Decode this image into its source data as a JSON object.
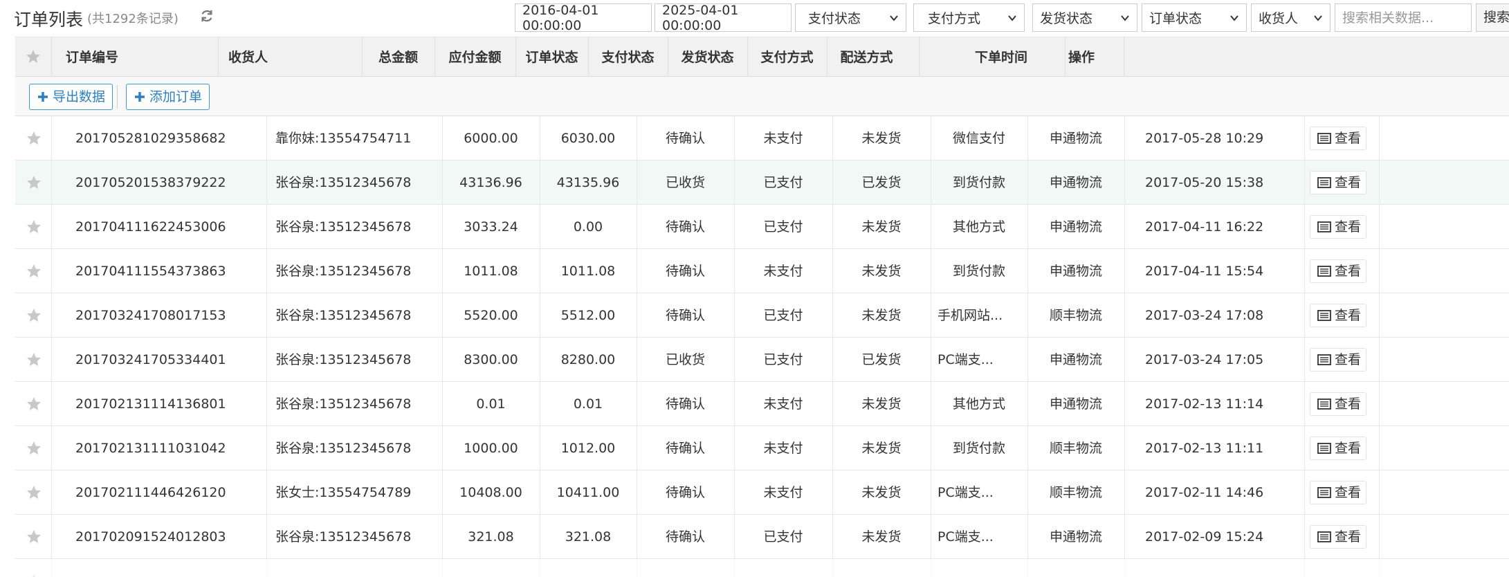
{
  "header": {
    "title": "订单列表",
    "record_count": "(共1292条记录)",
    "refresh_icon": "refresh-icon"
  },
  "filters": {
    "date_start": "2016-04-01 00:00:00",
    "date_end": "2025-04-01 00:00:00",
    "pay_status": "支付状态",
    "pay_method": "支付方式",
    "ship_status": "发货状态",
    "order_status": "订单状态",
    "receiver": "收货人",
    "search_placeholder": "搜索相关数据...",
    "search_button": "搜索"
  },
  "columns": {
    "order_no": "订单编号",
    "receiver": "收货人",
    "total": "总金额",
    "payable": "应付金额",
    "order_status": "订单状态",
    "pay_status": "支付状态",
    "ship_status": "发货状态",
    "pay_method": "支付方式",
    "delivery": "配送方式",
    "order_time": "下单时间",
    "actions": "操作"
  },
  "toolbar": {
    "export_label": "导出数据",
    "add_label": "添加订单"
  },
  "view_label": "查看",
  "colors": {
    "accent": "#2a7fc4",
    "row_highlight": "#f1f8f5",
    "header_bg": "#f1f1f1"
  },
  "rows": [
    {
      "order_no": "201705281029358682",
      "receiver": "靠你妹:13554754711",
      "total": "6000.00",
      "payable": "6030.00",
      "order_status": "待确认",
      "pay_status": "未支付",
      "ship_status": "未发货",
      "pay_method": "微信支付",
      "delivery": "申通物流",
      "time": "2017-05-28 10:29"
    },
    {
      "order_no": "201705201538379222",
      "receiver": "张谷泉:13512345678",
      "total": "43136.96",
      "payable": "43135.96",
      "order_status": "已收货",
      "pay_status": "已支付",
      "ship_status": "已发货",
      "pay_method": "到货付款",
      "delivery": "申通物流",
      "time": "2017-05-20 15:38"
    },
    {
      "order_no": "201704111622453006",
      "receiver": "张谷泉:13512345678",
      "total": "3033.24",
      "payable": "0.00",
      "order_status": "待确认",
      "pay_status": "已支付",
      "ship_status": "未发货",
      "pay_method": "其他方式",
      "delivery": "申通物流",
      "time": "2017-04-11 16:22"
    },
    {
      "order_no": "201704111554373863",
      "receiver": "张谷泉:13512345678",
      "total": "1011.08",
      "payable": "1011.08",
      "order_status": "待确认",
      "pay_status": "未支付",
      "ship_status": "未发货",
      "pay_method": "到货付款",
      "delivery": "申通物流",
      "time": "2017-04-11 15:54"
    },
    {
      "order_no": "201703241708017153",
      "receiver": "张谷泉:13512345678",
      "total": "5520.00",
      "payable": "5512.00",
      "order_status": "待确认",
      "pay_status": "已支付",
      "ship_status": "未发货",
      "pay_method": "手机网站...",
      "delivery": "顺丰物流",
      "time": "2017-03-24 17:08"
    },
    {
      "order_no": "201703241705334401",
      "receiver": "张谷泉:13512345678",
      "total": "8300.00",
      "payable": "8280.00",
      "order_status": "已收货",
      "pay_status": "已支付",
      "ship_status": "已发货",
      "pay_method": "PC端支...",
      "delivery": "申通物流",
      "time": "2017-03-24 17:05"
    },
    {
      "order_no": "201702131114136801",
      "receiver": "张谷泉:13512345678",
      "total": "0.01",
      "payable": "0.01",
      "order_status": "待确认",
      "pay_status": "未支付",
      "ship_status": "未发货",
      "pay_method": "其他方式",
      "delivery": "申通物流",
      "time": "2017-02-13 11:14"
    },
    {
      "order_no": "201702131111031042",
      "receiver": "张谷泉:13512345678",
      "total": "1000.00",
      "payable": "1012.00",
      "order_status": "待确认",
      "pay_status": "未支付",
      "ship_status": "未发货",
      "pay_method": "到货付款",
      "delivery": "顺丰物流",
      "time": "2017-02-13 11:11"
    },
    {
      "order_no": "201702111446426120",
      "receiver": "张女士:13554754789",
      "total": "10408.00",
      "payable": "10411.00",
      "order_status": "待确认",
      "pay_status": "未支付",
      "ship_status": "未发货",
      "pay_method": "PC端支...",
      "delivery": "顺丰物流",
      "time": "2017-02-11 14:46"
    },
    {
      "order_no": "201702091524012803",
      "receiver": "张谷泉:13512345678",
      "total": "321.08",
      "payable": "321.08",
      "order_status": "待确认",
      "pay_status": "已支付",
      "ship_status": "未发货",
      "pay_method": "PC端支...",
      "delivery": "申通物流",
      "time": "2017-02-09 15:24"
    }
  ]
}
